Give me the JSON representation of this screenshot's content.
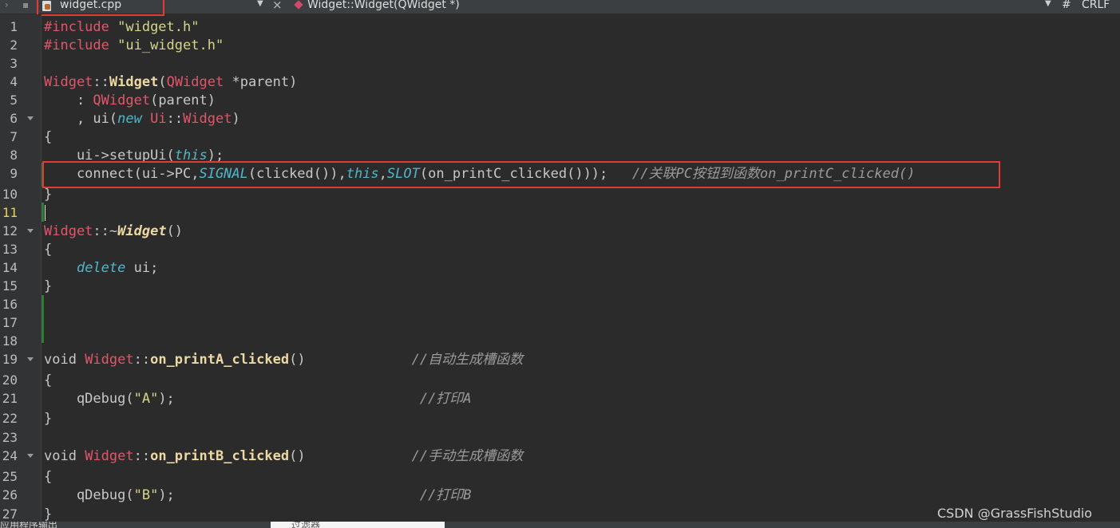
{
  "toolbar": {
    "file_name": "widget.cpp",
    "function_name": "Widget::Widget(QWidget *)",
    "hash": "#",
    "line_ending": "CRLF",
    "file_icon": "cpp-file-icon",
    "func_icon": "function-icon"
  },
  "gutter": {
    "line_numbers": [
      "1",
      "2",
      "3",
      "4",
      "5",
      "6",
      "7",
      "8",
      "9",
      "10",
      "11",
      "12",
      "13",
      "14",
      "15",
      "16",
      "17",
      "18",
      "19",
      "20",
      "21",
      "22",
      "23",
      "24",
      "25",
      "26",
      "27"
    ],
    "current_line": "11"
  },
  "code": {
    "l1_a": "#include",
    "l1_b": " \"widget.h\"",
    "l2_a": "#include",
    "l2_b": " \"ui_widget.h\"",
    "l4_a": "Widget",
    "l4_b": "::",
    "l4_c": "Widget",
    "l4_d": "(",
    "l4_e": "QWidget",
    "l4_f": " *parent)",
    "l5_a": "    : ",
    "l5_b": "QWidget",
    "l5_c": "(parent)",
    "l6_a": "    , ui(",
    "l6_b": "new",
    "l6_c": " ",
    "l6_d": "Ui",
    "l6_e": "::",
    "l6_f": "Widget",
    "l6_g": ")",
    "l7": "{",
    "l8_a": "    ui->setupUi(",
    "l8_b": "this",
    "l8_c": ");",
    "l9_a": "    connect(ui->PC,",
    "l9_b": "SIGNAL",
    "l9_c": "(clicked()),",
    "l9_d": "this",
    "l9_e": ",",
    "l9_f": "SLOT",
    "l9_g": "(on_printC_clicked()));   ",
    "l9_h": "//关联PC按钮到函数on_printC_clicked()",
    "l10": "}",
    "l12_a": "Widget",
    "l12_b": "::~",
    "l12_c": "Widget",
    "l12_d": "()",
    "l13": "{",
    "l14_a": "    ",
    "l14_b": "delete",
    "l14_c": " ui;",
    "l15": "}",
    "l19_a": "void ",
    "l19_b": "Widget",
    "l19_c": "::",
    "l19_d": "on_printA_clicked",
    "l19_e": "()             ",
    "l19_f": "//自动生成槽函数",
    "l20": "{",
    "l21_a": "    qDebug(",
    "l21_b": "\"A\"",
    "l21_c": ");                              ",
    "l21_d": "//打印A",
    "l22": "}",
    "l24_a": "void ",
    "l24_b": "Widget",
    "l24_c": "::",
    "l24_d": "on_printB_clicked",
    "l24_e": "()             ",
    "l24_f": "//手动生成槽函数",
    "l25": "{",
    "l26_a": "    qDebug(",
    "l26_b": "\"B\"",
    "l26_c": ");                              ",
    "l26_d": "//打印B",
    "l27": "}"
  },
  "bottom": {
    "output_label": "应用程序输出",
    "filter_placeholder": "过滤器"
  },
  "watermark": "CSDN @GrassFishStudio"
}
